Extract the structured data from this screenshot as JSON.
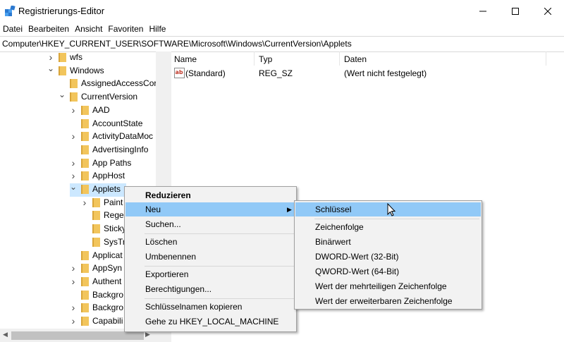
{
  "window": {
    "title": "Registrierungs-Editor"
  },
  "menubar": [
    "Datei",
    "Bearbeiten",
    "Ansicht",
    "Favoriten",
    "Hilfe"
  ],
  "address": "Computer\\HKEY_CURRENT_USER\\SOFTWARE\\Microsoft\\Windows\\CurrentVersion\\Applets",
  "tree": {
    "items": [
      {
        "label": "wfs",
        "expander": "collapsed"
      },
      {
        "label": "Windows",
        "expander": "expanded"
      },
      {
        "label": "AssignedAccessCor",
        "expander": "none"
      },
      {
        "label": "CurrentVersion",
        "expander": "expanded"
      },
      {
        "label": "AAD",
        "expander": "collapsed"
      },
      {
        "label": "AccountState",
        "expander": "none"
      },
      {
        "label": "ActivityDataMoc",
        "expander": "collapsed"
      },
      {
        "label": "AdvertisingInfo",
        "expander": "none"
      },
      {
        "label": "App Paths",
        "expander": "collapsed"
      },
      {
        "label": "AppHost",
        "expander": "collapsed"
      },
      {
        "label": "Applets",
        "expander": "expanded"
      },
      {
        "label": "Paint",
        "expander": "collapsed"
      },
      {
        "label": "Rege",
        "expander": "none"
      },
      {
        "label": "Sticky",
        "expander": "none"
      },
      {
        "label": "SysTr",
        "expander": "none"
      },
      {
        "label": "Applicat",
        "expander": "none"
      },
      {
        "label": "AppSyn",
        "expander": "collapsed"
      },
      {
        "label": "Authent",
        "expander": "collapsed"
      },
      {
        "label": "Backgro",
        "expander": "none"
      },
      {
        "label": "Backgro",
        "expander": "collapsed"
      },
      {
        "label": "Capabili",
        "expander": "collapsed"
      }
    ]
  },
  "list": {
    "columns": [
      "Name",
      "Typ",
      "Daten"
    ],
    "rows": [
      {
        "name": "(Standard)",
        "type": "REG_SZ",
        "data": "(Wert nicht festgelegt)"
      }
    ]
  },
  "context_menu": {
    "items": [
      {
        "label": "Reduzieren",
        "bold": true
      },
      {
        "label": "Neu",
        "submenu": true,
        "highlighted": true
      },
      {
        "label": "Suchen..."
      },
      {
        "label": "Löschen"
      },
      {
        "label": "Umbenennen"
      },
      {
        "label": "Exportieren"
      },
      {
        "label": "Berechtigungen..."
      },
      {
        "label": "Schlüsselnamen kopieren"
      },
      {
        "label": "Gehe zu HKEY_LOCAL_MACHINE"
      }
    ]
  },
  "submenu": {
    "items": [
      {
        "label": "Schlüssel",
        "highlighted": true
      },
      {
        "label": "Zeichenfolge"
      },
      {
        "label": "Binärwert"
      },
      {
        "label": "DWORD-Wert (32-Bit)"
      },
      {
        "label": "QWORD-Wert (64-Bit)"
      },
      {
        "label": "Wert der mehrteiligen Zeichenfolge"
      },
      {
        "label": "Wert der erweiterbaren Zeichenfolge"
      }
    ]
  },
  "colors": {
    "highlight": "#91c9f7",
    "selection": "#cce8ff",
    "folder": "#f2c55c"
  }
}
